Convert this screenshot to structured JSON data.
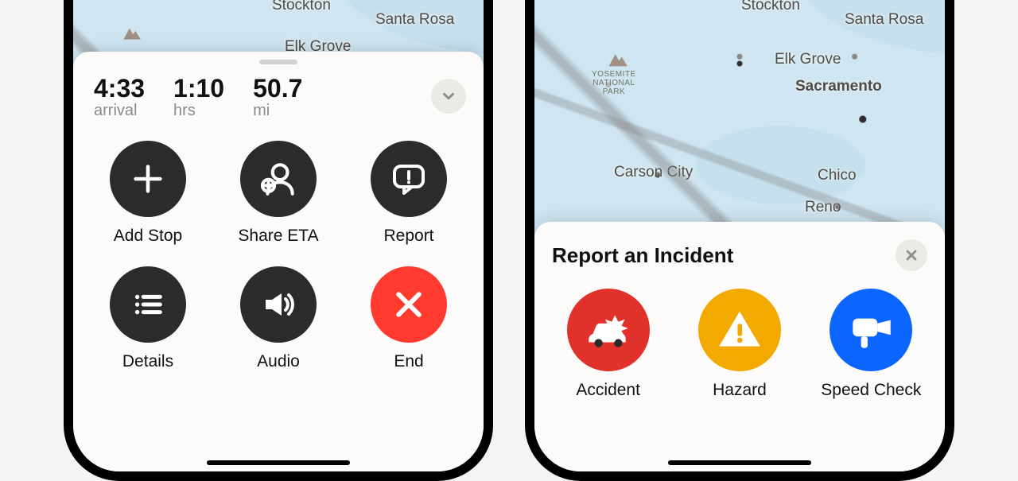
{
  "map": {
    "labels": {
      "stockton": "Stockton",
      "santa_rosa": "Santa Rosa",
      "elk_grove": "Elk Grove",
      "sacramento": "Sacramento",
      "carson_city": "Carson City",
      "chico": "Chico",
      "reno": "Reno",
      "yosemite": "YOSEMITE\nNATIONAL\nPARK"
    }
  },
  "nav_sheet": {
    "arrival_value": "4:33",
    "arrival_label": "arrival",
    "duration_value": "1:10",
    "duration_label": "hrs",
    "distance_value": "50.7",
    "distance_label": "mi",
    "actions": {
      "add_stop": "Add Stop",
      "share_eta": "Share ETA",
      "report": "Report",
      "details": "Details",
      "audio": "Audio",
      "end": "End"
    }
  },
  "incident_sheet": {
    "title": "Report an Incident",
    "items": {
      "accident": "Accident",
      "hazard": "Hazard",
      "speed_check": "Speed Check"
    }
  }
}
